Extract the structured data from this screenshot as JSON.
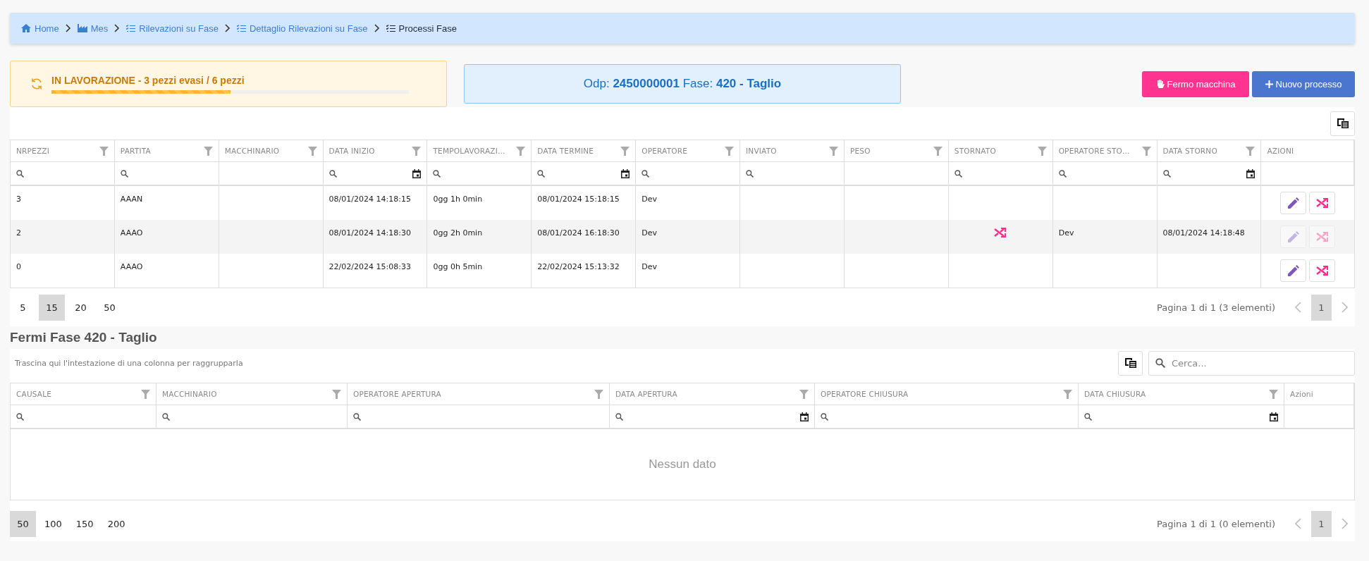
{
  "breadcrumb": [
    {
      "label": "Home",
      "kind": "home",
      "current": false
    },
    {
      "label": "Mes",
      "kind": "factory",
      "current": false
    },
    {
      "label": "Rilevazioni su Fase",
      "kind": "list",
      "current": false
    },
    {
      "label": "Dettaglio Rilevazioni su Fase",
      "kind": "list",
      "current": false
    },
    {
      "label": "Processi Fase",
      "kind": "list",
      "current": true
    }
  ],
  "status": {
    "text": "IN LAVORAZIONE - 3 pezzi evasi / 6 pezzi",
    "level": 0.5
  },
  "order": {
    "text": "Odp: **2450000001** Fase: **420 - Taglio**"
  },
  "buttons": [
    {
      "label": "Fermo macchina",
      "kind": "stop"
    },
    {
      "label": "Nuovo processo",
      "kind": "add"
    }
  ],
  "processes": {
    "columns": [
      {
        "label": "NRPEZZI",
        "menu": true,
        "search": true,
        "date_picker": false
      },
      {
        "label": "PARTITA",
        "menu": true,
        "search": true,
        "date_picker": false
      },
      {
        "label": "MACCHINARIO",
        "menu": true,
        "search": false
      },
      {
        "label": "DATA INIZIO",
        "menu": true,
        "search": true,
        "date_picker": true
      },
      {
        "label": "TEMPOLAVORAZI…",
        "menu": true,
        "search": true,
        "date_picker": false
      },
      {
        "label": "DATA TERMINE",
        "menu": true,
        "search": true,
        "date_picker": true
      },
      {
        "label": "OPERATORE",
        "menu": true,
        "search": true,
        "date_picker": false
      },
      {
        "label": "INVIATO",
        "menu": true,
        "search": true,
        "date_picker": false
      },
      {
        "label": "PESO",
        "menu": true,
        "search": false
      },
      {
        "label": "STORNATO",
        "menu": true,
        "search": true,
        "date_picker": false
      },
      {
        "label": "OPERATORE STO…",
        "menu": true,
        "search": true,
        "date_picker": false
      },
      {
        "label": "DATA STORNO",
        "menu": true,
        "search": true,
        "date_picker": true
      },
      {
        "label": "AZIONI",
        "menu": false,
        "search": false
      }
    ],
    "rows": [
      {
        "cells": [
          "3",
          "AAAN",
          null,
          "08/01/2024 14:18:15",
          "0gg 1h 0min",
          "08/01/2024 15:18:15",
          "Dev",
          null,
          null,
          null,
          null,
          null
        ],
        "stornato": false,
        "actions": [
          {
            "kind": "edit",
            "disabled": false
          },
          {
            "kind": "reverse",
            "disabled": false
          }
        ]
      },
      {
        "cells": [
          "2",
          "AAAO",
          null,
          "08/01/2024 14:18:30",
          "0gg 2h 0min",
          "08/01/2024 16:18:30",
          "Dev",
          null,
          null,
          null,
          "Dev",
          "08/01/2024 14:18:48"
        ],
        "stornato": true,
        "actions": [
          {
            "kind": "edit",
            "disabled": true
          },
          {
            "kind": "reverse",
            "disabled": true
          }
        ]
      },
      {
        "cells": [
          "0",
          "AAAO",
          null,
          "22/02/2024 15:08:33",
          "0gg 0h 5min",
          "22/02/2024 15:13:32",
          "Dev",
          null,
          null,
          null,
          null,
          null
        ],
        "stornato": false,
        "actions": [
          {
            "kind": "edit",
            "disabled": false
          },
          {
            "kind": "reverse",
            "disabled": false
          }
        ]
      }
    ],
    "pager": {
      "sizes": [
        {
          "label": "5",
          "selected": false
        },
        {
          "label": "15",
          "selected": true
        },
        {
          "label": "20",
          "selected": false
        },
        {
          "label": "50",
          "selected": false
        }
      ],
      "info": "Pagina 1 di 1 (3 elementi)",
      "pages": [
        {
          "label": "1",
          "selected": true
        }
      ]
    }
  },
  "stops": {
    "title": "Fermi Fase 420 - Taglio",
    "group_hint": "Trascina qui l'intestazione di una colonna per raggrupparla",
    "search": {
      "placeholder": "Cerca..."
    },
    "columns": [
      {
        "label": "CAUSALE",
        "menu": true,
        "search": true,
        "date_picker": false
      },
      {
        "label": "MACCHINARIO",
        "menu": true,
        "search": true,
        "date_picker": false
      },
      {
        "label": "OPERATORE APERTURA",
        "menu": true,
        "search": true,
        "date_picker": false
      },
      {
        "label": "DATA APERTURA",
        "menu": true,
        "search": true,
        "date_picker": true
      },
      {
        "label": "OPERATORE CHIUSURA",
        "menu": true,
        "search": true,
        "date_picker": false
      },
      {
        "label": "DATA CHIUSURA",
        "menu": true,
        "search": true,
        "date_picker": true
      },
      {
        "label": "Azioni",
        "menu": false,
        "search": false
      }
    ],
    "empty_text": "Nessun dato",
    "pager": {
      "sizes": [
        {
          "label": "50",
          "selected": true
        },
        {
          "label": "100",
          "selected": false
        },
        {
          "label": "150",
          "selected": false
        },
        {
          "label": "200",
          "selected": false
        }
      ],
      "info": "Pagina 1 di 1 (0 elementi)",
      "pages": [
        {
          "label": "1",
          "selected": true
        }
      ]
    }
  }
}
